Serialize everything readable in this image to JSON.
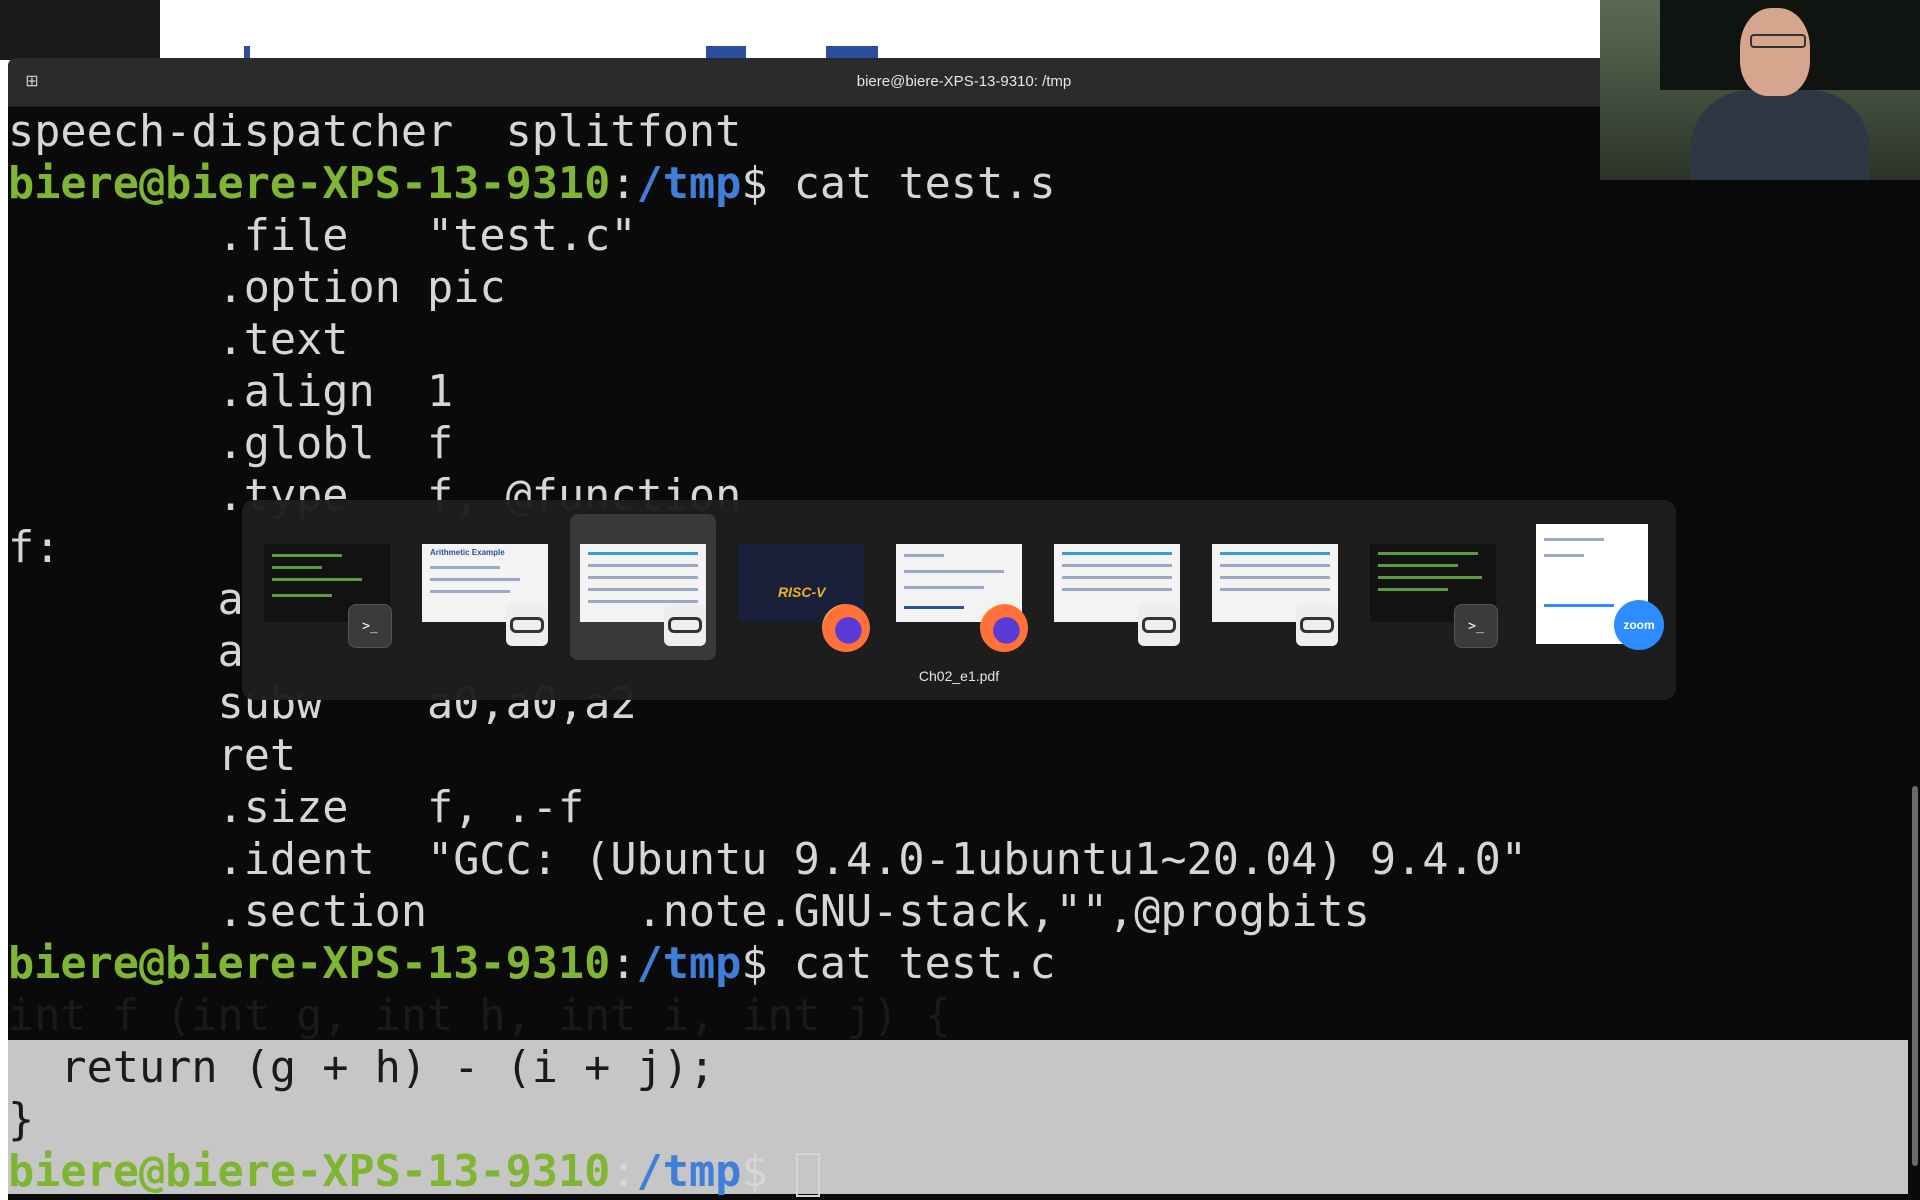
{
  "window": {
    "title": "biere@biere-XPS-13-9310: /tmp",
    "new_tab_icon": "new-tab-icon"
  },
  "terminal": {
    "prompt_user": "biere@biere-XPS-13-9310",
    "prompt_path": "/tmp",
    "prompt_symbol": "$",
    "lines": {
      "l0": "speech-dispatcher  splitfont",
      "l1_cmd": " cat test.s",
      "l2": "        .file   \"test.c\"",
      "l3": "        .option pic",
      "l4": "        .text",
      "l5": "        .align  1",
      "l6": "        .globl  f",
      "l7": "        .type   f, @function",
      "l8": "f:",
      "l9": "        a",
      "l10": "        a",
      "l11": "        subw    a0,a0,a2",
      "l12": "        ret",
      "l13": "        .size   f, .-f",
      "l14": "        .ident  \"GCC: (Ubuntu 9.4.0-1ubuntu1~20.04) 9.4.0\"",
      "l15": "        .section        .note.GNU-stack,\"\",@progbits",
      "l16_cmd": " cat test.c",
      "l17": "int f (int g, int h, int i, int j) {",
      "l18": "  return (g + h) - (i + j);",
      "l19": "}"
    }
  },
  "switcher": {
    "selected_label": "Ch02_e1.pdf",
    "items": [
      {
        "app": "terminal",
        "badge_text": ">_"
      },
      {
        "app": "document-viewer",
        "thumb_title": "Arithmetic Example"
      },
      {
        "app": "document-viewer",
        "selected": true
      },
      {
        "app": "firefox",
        "thumb_title": "RISC-V"
      },
      {
        "app": "firefox"
      },
      {
        "app": "document-viewer"
      },
      {
        "app": "document-viewer"
      },
      {
        "app": "terminal",
        "badge_text": ">_"
      },
      {
        "app": "zoom",
        "badge_text": "zoom"
      }
    ]
  },
  "colors": {
    "prompt_user": "#7fb532",
    "prompt_path": "#3f7fd8",
    "terminal_bg": "#0a0a0a",
    "selection_bg": "#c6c6c6"
  }
}
